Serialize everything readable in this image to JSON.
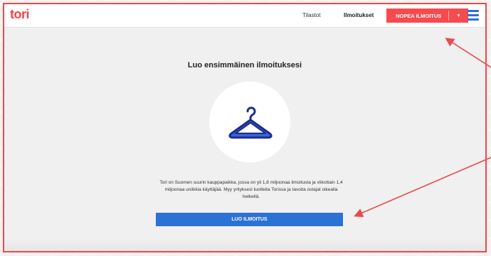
{
  "header": {
    "logo": "tori",
    "nav": {
      "stats": "Tilastot",
      "ads": "Ilmoitukset"
    },
    "cta_label": "NOPEA ILMOITUS",
    "cta_caret": "▾",
    "menu_icon": "hamburger-icon"
  },
  "main": {
    "heading": "Luo ensimmäinen ilmoituksesi",
    "illustration_icon": "hanger-icon",
    "description": "Tori on Suomen suurin kauppapaikka, jossa on yli 1,8 miljoonaa ilmoitusta ja viikottain 1,4 miljoonaa uniikkia käyttäjää. Myy yrityksesi tuotteita Torissa ja tavoita ostajat oikealla hetkellä.",
    "create_button": "LUO ILMOITUS"
  },
  "colors": {
    "brand_red": "#f64245",
    "button_blue": "#2a72d3",
    "annotation_red": "#e84a4f"
  }
}
